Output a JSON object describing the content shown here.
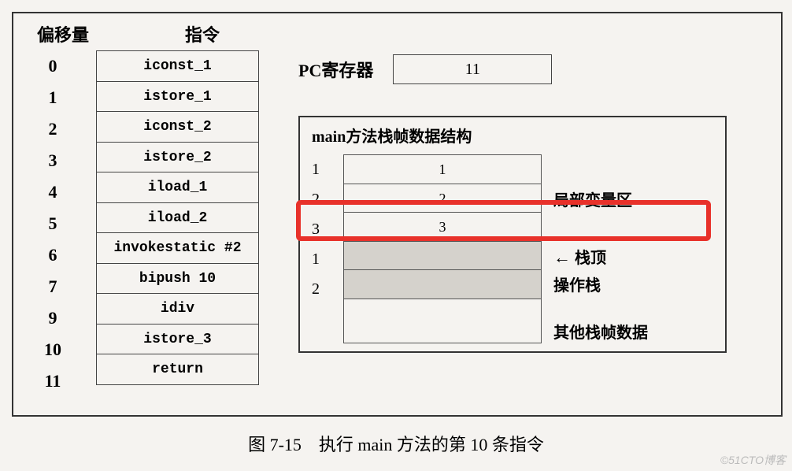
{
  "headers": {
    "offset": "偏移量",
    "instruction": "指令"
  },
  "instructions": [
    {
      "offset": "0",
      "text": "iconst_1"
    },
    {
      "offset": "1",
      "text": "istore_1"
    },
    {
      "offset": "2",
      "text": "iconst_2"
    },
    {
      "offset": "3",
      "text": "istore_2"
    },
    {
      "offset": "4",
      "text": "iload_1"
    },
    {
      "offset": "5",
      "text": "iload_2"
    },
    {
      "offset": "6",
      "text": "invokestatic  #2"
    },
    {
      "offset": "7",
      "text": "bipush  10"
    },
    {
      "offset": "9",
      "text": "idiv"
    },
    {
      "offset": "10",
      "text": "istore_3"
    },
    {
      "offset": "11",
      "text": "return"
    }
  ],
  "pc": {
    "label": "PC寄存器",
    "value": "11"
  },
  "stackframe": {
    "title": "main方法栈帧数据结构",
    "locals": [
      {
        "idx": "1",
        "val": "1"
      },
      {
        "idx": "2",
        "val": "2"
      },
      {
        "idx": "3",
        "val": "3"
      }
    ],
    "opstack": [
      {
        "idx": "1",
        "val": ""
      },
      {
        "idx": "2",
        "val": ""
      }
    ],
    "labels": {
      "local_var": "局部变量区",
      "stack_top": "栈顶",
      "op_stack": "操作栈",
      "other": "其他栈帧数据"
    }
  },
  "caption": "图 7-15　执行 main 方法的第 10 条指令",
  "watermark": "©51CTO博客"
}
